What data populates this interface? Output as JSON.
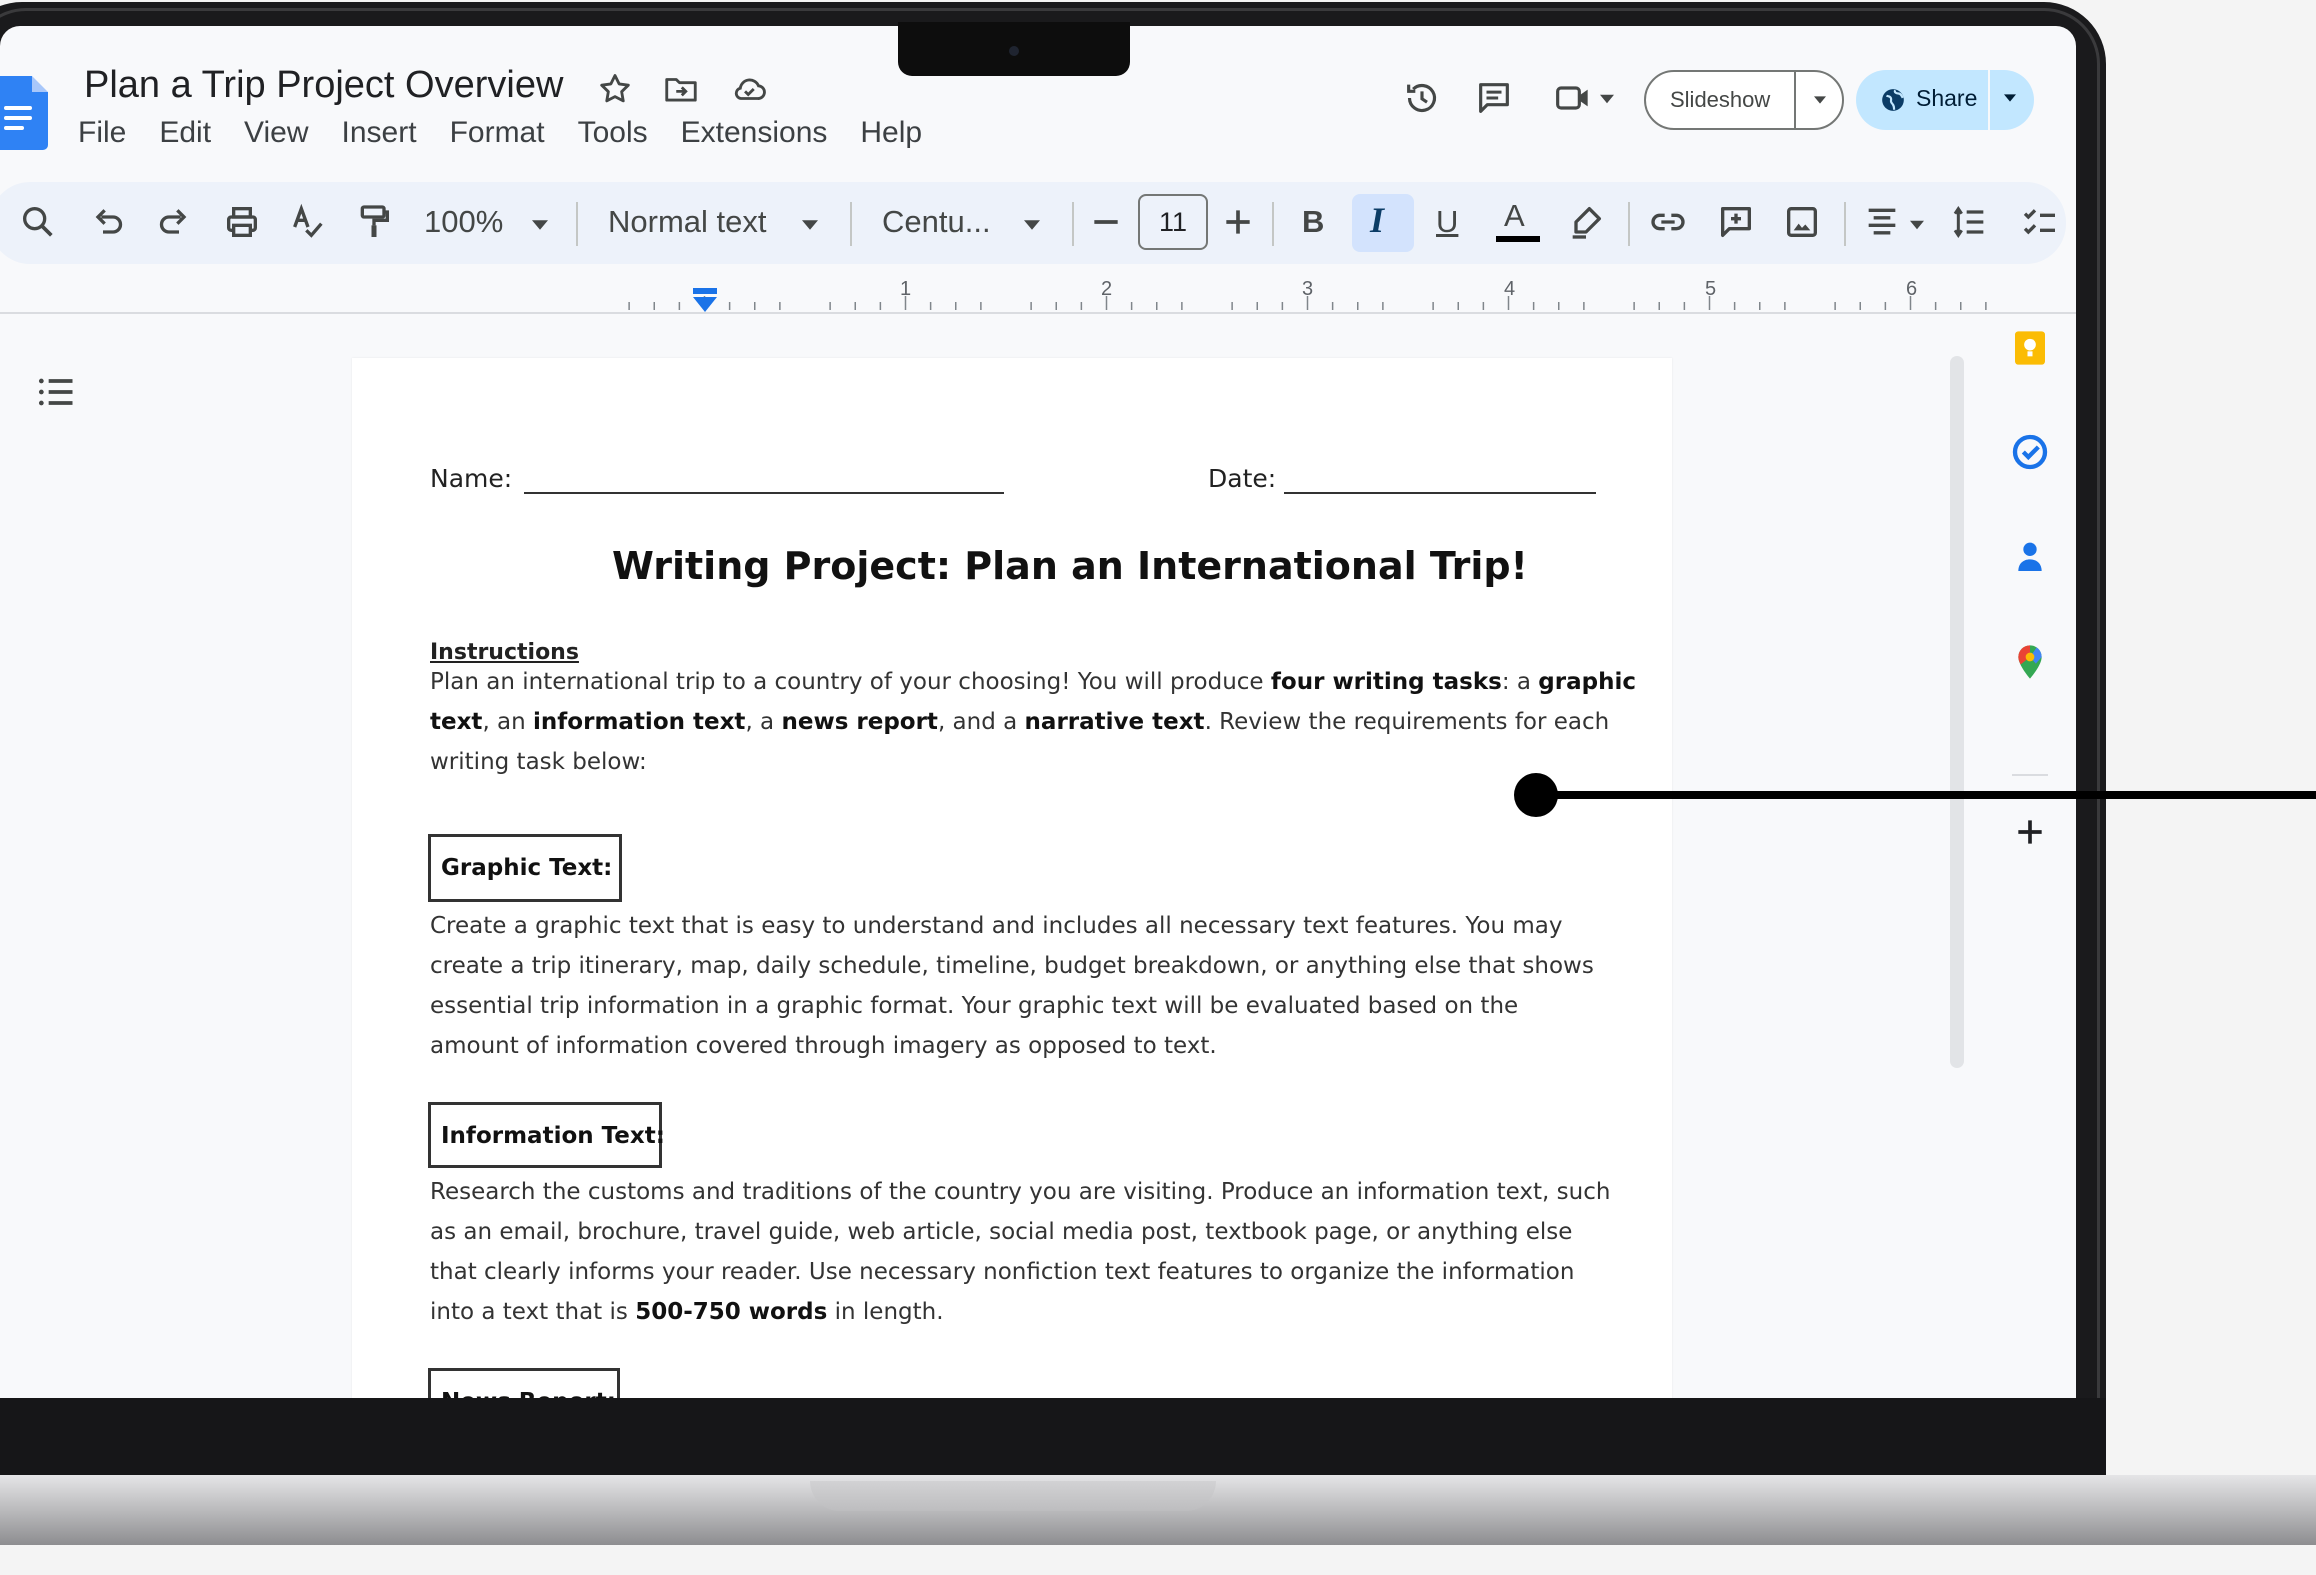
{
  "doc": {
    "title": "Plan a Trip Project Overview",
    "menu": [
      "File",
      "Edit",
      "View",
      "Insert",
      "Format",
      "Tools",
      "Extensions",
      "Help"
    ]
  },
  "header": {
    "slideshow_label": "Slideshow",
    "share_label": "Share"
  },
  "toolbar": {
    "zoom": "100%",
    "style": "Normal text",
    "font": "Centu...",
    "font_size": "11",
    "bold_label": "B",
    "italic_label": "I",
    "underline_label": "U",
    "textcolor_label": "A"
  },
  "ruler": {
    "numbers": [
      "1",
      "2",
      "3",
      "4",
      "5",
      "6"
    ]
  },
  "page": {
    "name_label": "Name:",
    "date_label": "Date:",
    "heading": "Writing Project: Plan an International Trip!",
    "instructions_label": "Instructions",
    "intro": {
      "l1a": "Plan an international trip to a country of your choosing! You will produce ",
      "l1b": "four writing tasks",
      "l1c": ": a ",
      "l1d": "graphic",
      "l2a": "text",
      "l2b": ", an ",
      "l2c": "information text",
      "l2d": ", a ",
      "l2e": "news report",
      "l2f": ", and a ",
      "l2g": "narrative text",
      "l2h": ". Review the requirements for each",
      "l3": "writing task below:"
    },
    "graphic": {
      "label": "Graphic Text:",
      "lines": [
        "Create a graphic text that is easy to understand and includes all necessary text features. You may",
        "create a trip itinerary, map, daily schedule, timeline, budget breakdown, or anything else that shows",
        "essential trip information in a graphic format. Your graphic text will be evaluated based on the",
        "amount of information covered through imagery as opposed to text."
      ]
    },
    "information": {
      "label": "Information Text:",
      "lines": [
        "Research the customs and traditions of the country you are visiting. Produce an information text, such",
        "as an email, brochure, travel guide, web article, social media post, textbook page, or anything else",
        "that clearly informs your reader. Use necessary nonfiction text features to organize the information"
      ],
      "last_a": "into a text that is ",
      "last_b": "500-750 words",
      "last_c": " in length."
    },
    "news": {
      "label": "News Report:"
    }
  },
  "colors": {
    "accent": "#0b57d0",
    "share_bg": "#c2e7ff",
    "toolbar_bg": "#edf2fa",
    "italic_active": "#d3e3fd"
  },
  "icons": {
    "title": [
      "star-icon",
      "move-to-folder-icon",
      "cloud-saved-icon"
    ],
    "header": [
      "version-history-icon",
      "comments-icon",
      "meet-icon"
    ],
    "toolbar": [
      "search-icon",
      "undo-icon",
      "redo-icon",
      "print-icon",
      "spellcheck-icon",
      "paint-format-icon",
      "link-icon",
      "add-comment-icon",
      "insert-image-icon",
      "align-icon",
      "line-spacing-icon",
      "checklist-icon"
    ],
    "side": [
      "keep-icon",
      "tasks-icon",
      "contacts-icon",
      "maps-icon",
      "add-icon"
    ]
  }
}
